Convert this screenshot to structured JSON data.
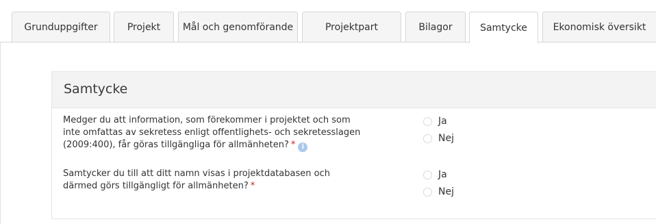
{
  "tabs": [
    {
      "label": "Grunduppgifter"
    },
    {
      "label": "Projekt"
    },
    {
      "label": "Mål och genomförande"
    },
    {
      "label": "Projektpart"
    },
    {
      "label": "Bilagor"
    },
    {
      "label": "Samtycke"
    },
    {
      "label": "Ekonomisk översikt"
    }
  ],
  "active_tab": "Samtycke",
  "panel": {
    "title": "Samtycke",
    "questions": [
      {
        "lines": [
          "Medger du att information, som förekommer i projektet och som",
          "inte omfattas av sekretess enligt offentlighets- och sekretesslagen",
          "(2009:400), får göras tillgängliga för allmänheten?"
        ],
        "required_mark": "*",
        "info_icon": "info-icon",
        "options": [
          "Ja",
          "Nej"
        ]
      },
      {
        "lines": [
          "Samtycker du till att ditt namn visas i projektdatabasen och",
          "därmed görs tillgängligt för allmänheten?"
        ],
        "required_mark": "*",
        "options": [
          "Ja",
          "Nej"
        ]
      }
    ]
  },
  "colors": {
    "tab_background": "#f5f5f5",
    "panel_header": "#f3f3f3",
    "required": "#cc1f1f",
    "info": "#a9c9ec"
  }
}
